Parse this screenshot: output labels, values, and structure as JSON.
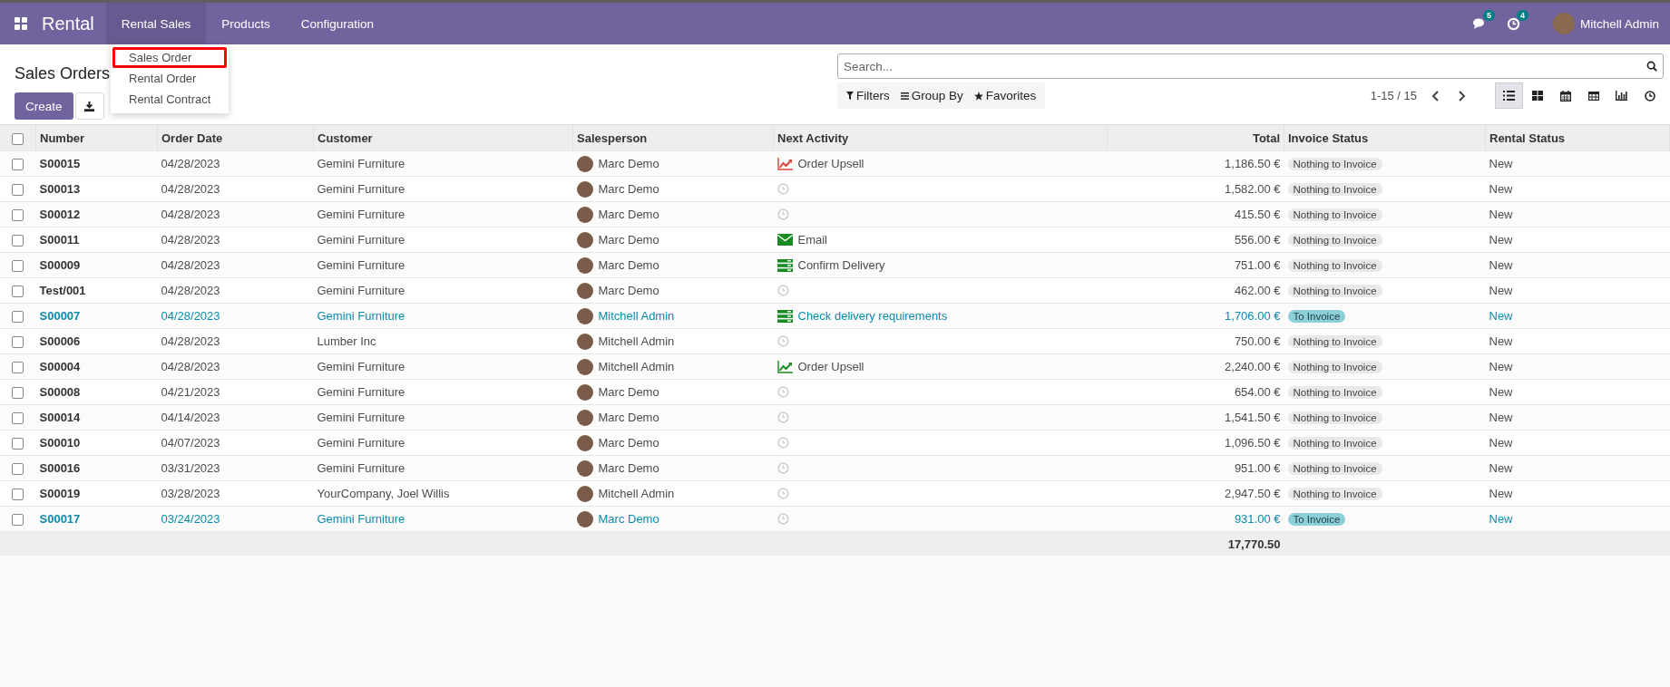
{
  "navbar": {
    "app_name": "Rental",
    "menus": [
      {
        "label": "Rental Sales",
        "selected": true
      },
      {
        "label": "Products",
        "selected": false
      },
      {
        "label": "Configuration",
        "selected": false
      }
    ],
    "messages_count": "5",
    "activities_count": "4",
    "user_name": "Mitchell Admin"
  },
  "dropdown": {
    "items": [
      {
        "label": "Sales Order",
        "highlighted": true
      },
      {
        "label": "Rental Order",
        "highlighted": false
      },
      {
        "label": "Rental Contract",
        "highlighted": false
      }
    ]
  },
  "control_panel": {
    "title": "Sales Orders",
    "create_label": "Create",
    "search_placeholder": "Search...",
    "filters_label": "Filters",
    "group_by_label": "Group By",
    "favorites_label": "Favorites",
    "pager": "1-15 / 15",
    "views": [
      {
        "kind": "list",
        "selected": true
      },
      {
        "kind": "kanban",
        "selected": false
      },
      {
        "kind": "calendar",
        "selected": false
      },
      {
        "kind": "pivot",
        "selected": false
      },
      {
        "kind": "graph",
        "selected": false
      },
      {
        "kind": "activity",
        "selected": false
      }
    ]
  },
  "table": {
    "all_selected": false,
    "columns": [
      "Number",
      "Order Date",
      "Customer",
      "Salesperson",
      "Next Activity",
      "Total",
      "Invoice Status",
      "Rental Status"
    ],
    "rows": [
      {
        "number": "S00015",
        "date": "04/28/2023",
        "customer": "Gemini Furniture",
        "salesperson": "Marc Demo",
        "activity": {
          "kind": "upsell",
          "overdue": true,
          "label": "Order Upsell"
        },
        "total": "1,186.50 €",
        "invoice": {
          "kind": "nothing",
          "label": "Nothing to Invoice"
        },
        "rental_status": "New"
      },
      {
        "number": "S00013",
        "date": "04/28/2023",
        "customer": "Gemini Furniture",
        "salesperson": "Marc Demo",
        "activity": {
          "kind": "none"
        },
        "total": "1,582.00 €",
        "invoice": {
          "kind": "nothing",
          "label": "Nothing to Invoice"
        },
        "rental_status": "New"
      },
      {
        "number": "S00012",
        "date": "04/28/2023",
        "customer": "Gemini Furniture",
        "salesperson": "Marc Demo",
        "activity": {
          "kind": "none"
        },
        "total": "415.50 €",
        "invoice": {
          "kind": "nothing",
          "label": "Nothing to Invoice"
        },
        "rental_status": "New"
      },
      {
        "number": "S00011",
        "date": "04/28/2023",
        "customer": "Gemini Furniture",
        "salesperson": "Marc Demo",
        "activity": {
          "kind": "email",
          "overdue": false,
          "label": "Email"
        },
        "total": "556.00 €",
        "invoice": {
          "kind": "nothing",
          "label": "Nothing to Invoice"
        },
        "rental_status": "New"
      },
      {
        "number": "S00009",
        "date": "04/28/2023",
        "customer": "Gemini Furniture",
        "salesperson": "Marc Demo",
        "activity": {
          "kind": "todo",
          "overdue": false,
          "label": "Confirm Delivery"
        },
        "total": "751.00 €",
        "invoice": {
          "kind": "nothing",
          "label": "Nothing to Invoice"
        },
        "rental_status": "New"
      },
      {
        "number": "Test/001",
        "date": "04/28/2023",
        "customer": "Gemini Furniture",
        "salesperson": "Marc Demo",
        "activity": {
          "kind": "none"
        },
        "total": "462.00 €",
        "invoice": {
          "kind": "nothing",
          "label": "Nothing to Invoice"
        },
        "rental_status": "New"
      },
      {
        "number": "S00007",
        "date": "04/28/2023",
        "customer": "Gemini Furniture",
        "salesperson": "Mitchell Admin",
        "activity": {
          "kind": "todo",
          "overdue": false,
          "label": "Check delivery requirements"
        },
        "total": "1,706.00 €",
        "invoice": {
          "kind": "to_invoice",
          "label": "To Invoice"
        },
        "rental_status": "New"
      },
      {
        "number": "S00006",
        "date": "04/28/2023",
        "customer": "Lumber Inc",
        "salesperson": "Mitchell Admin",
        "activity": {
          "kind": "none"
        },
        "total": "750.00 €",
        "invoice": {
          "kind": "nothing",
          "label": "Nothing to Invoice"
        },
        "rental_status": "New"
      },
      {
        "number": "S00004",
        "date": "04/28/2023",
        "customer": "Gemini Furniture",
        "salesperson": "Mitchell Admin",
        "activity": {
          "kind": "upsell",
          "overdue": false,
          "label": "Order Upsell"
        },
        "total": "2,240.00 €",
        "invoice": {
          "kind": "nothing",
          "label": "Nothing to Invoice"
        },
        "rental_status": "New"
      },
      {
        "number": "S00008",
        "date": "04/21/2023",
        "customer": "Gemini Furniture",
        "salesperson": "Marc Demo",
        "activity": {
          "kind": "none"
        },
        "total": "654.00 €",
        "invoice": {
          "kind": "nothing",
          "label": "Nothing to Invoice"
        },
        "rental_status": "New"
      },
      {
        "number": "S00014",
        "date": "04/14/2023",
        "customer": "Gemini Furniture",
        "salesperson": "Marc Demo",
        "activity": {
          "kind": "none"
        },
        "total": "1,541.50 €",
        "invoice": {
          "kind": "nothing",
          "label": "Nothing to Invoice"
        },
        "rental_status": "New"
      },
      {
        "number": "S00010",
        "date": "04/07/2023",
        "customer": "Gemini Furniture",
        "salesperson": "Marc Demo",
        "activity": {
          "kind": "none"
        },
        "total": "1,096.50 €",
        "invoice": {
          "kind": "nothing",
          "label": "Nothing to Invoice"
        },
        "rental_status": "New"
      },
      {
        "number": "S00016",
        "date": "03/31/2023",
        "customer": "Gemini Furniture",
        "salesperson": "Marc Demo",
        "activity": {
          "kind": "none"
        },
        "total": "951.00 €",
        "invoice": {
          "kind": "nothing",
          "label": "Nothing to Invoice"
        },
        "rental_status": "New"
      },
      {
        "number": "S00019",
        "date": "03/28/2023",
        "customer": "YourCompany, Joel Willis",
        "salesperson": "Mitchell Admin",
        "activity": {
          "kind": "none"
        },
        "total": "2,947.50 €",
        "invoice": {
          "kind": "nothing",
          "label": "Nothing to Invoice"
        },
        "rental_status": "New"
      },
      {
        "number": "S00017",
        "date": "03/24/2023",
        "customer": "Gemini Furniture",
        "salesperson": "Marc Demo",
        "activity": {
          "kind": "none"
        },
        "total": "931.00 €",
        "invoice": {
          "kind": "to_invoice",
          "label": "To Invoice"
        },
        "rental_status": "New"
      }
    ],
    "grand_total": "17,770.50"
  }
}
